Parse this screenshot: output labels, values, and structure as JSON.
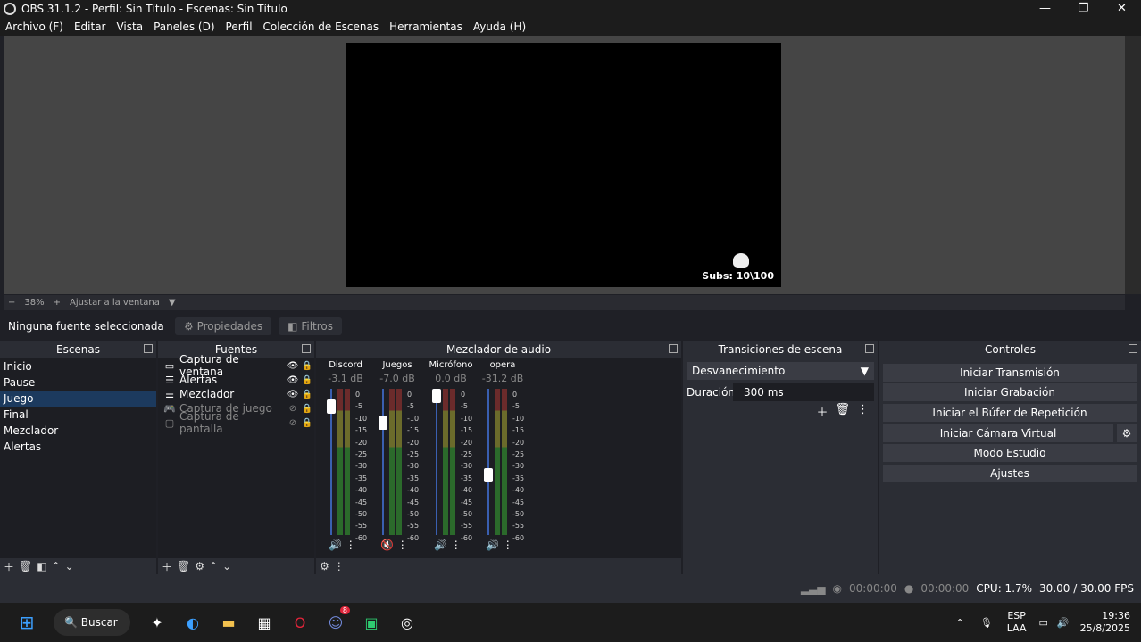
{
  "window": {
    "title": "OBS 31.1.2 - Perfil: Sin Título - Escenas: Sin Título"
  },
  "menu": [
    "Archivo (F)",
    "Editar",
    "Vista",
    "Paneles (D)",
    "Perfil",
    "Colección de Escenas",
    "Herramientas",
    "Ayuda (H)"
  ],
  "preview": {
    "overlay_text": "Subs: 10\\100"
  },
  "zoombar": {
    "minus": "−",
    "zoom": "38%",
    "plus": "+",
    "fit": "Ajustar a la ventana"
  },
  "sourcebar": {
    "selected": "Ninguna fuente seleccionada",
    "properties": "Propiedades",
    "filters": "Filtros"
  },
  "docks": {
    "scenes": "Escenas",
    "sources": "Fuentes",
    "mixer": "Mezclador de audio",
    "transitions": "Transiciones de escena",
    "controls": "Controles"
  },
  "scenes": [
    "Inicio",
    "Pause",
    "Juego",
    "Final",
    "Mezclador",
    "Alertas"
  ],
  "sources": [
    {
      "name": "Captura de ventana",
      "icon": "window-icon",
      "visible": true
    },
    {
      "name": "Alertas",
      "icon": "list-icon",
      "visible": true
    },
    {
      "name": "Mezclador",
      "icon": "list-icon",
      "visible": true
    },
    {
      "name": "Captura de juego",
      "icon": "gamepad-icon",
      "visible": false
    },
    {
      "name": "Captura de pantalla",
      "icon": "monitor-icon",
      "visible": false
    }
  ],
  "mixer": [
    {
      "name": "Discord",
      "db": "-3.1 dB",
      "level": 0.92,
      "muted": false
    },
    {
      "name": "Juegos",
      "db": "-7.0 dB",
      "level": 0.8,
      "muted": true
    },
    {
      "name": "Micrófono",
      "db": "0.0 dB",
      "level": 1.0,
      "muted": false
    },
    {
      "name": "opera",
      "db": "-31.2 dB",
      "level": 0.4,
      "muted": false
    }
  ],
  "scale": [
    "0",
    "-5",
    "-10",
    "-15",
    "-20",
    "-25",
    "-30",
    "-35",
    "-40",
    "-45",
    "-50",
    "-55",
    "-60"
  ],
  "transitions": {
    "type": "Desvanecimiento",
    "duration_label": "Duración",
    "duration": "300 ms"
  },
  "controls": [
    "Iniciar Transmisión",
    "Iniciar Grabación",
    "Iniciar el Búfer de Repetición",
    "Iniciar Cámara Virtual",
    "Modo Estudio",
    "Ajustes"
  ],
  "status": {
    "rec_time": "00:00:00",
    "stream_time": "00:00:00",
    "cpu": "CPU: 1.7%",
    "fps": "30.00 / 30.00 FPS"
  },
  "taskbar": {
    "search": "Buscar",
    "badge": "8"
  },
  "tray": {
    "lang1": "ESP",
    "lang2": "LAA",
    "time": "19:36",
    "date": "25/8/2025"
  }
}
